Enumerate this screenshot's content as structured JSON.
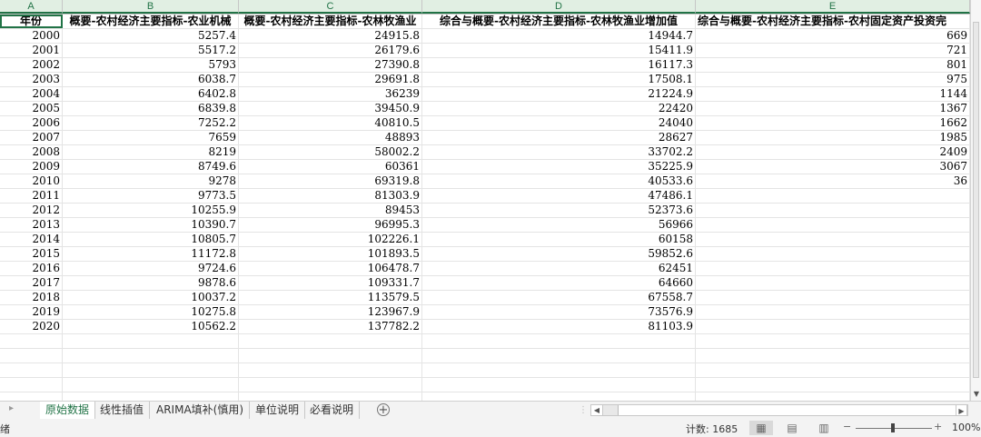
{
  "columns": [
    "A",
    "B",
    "C",
    "D",
    "E"
  ],
  "headers": [
    "年份",
    "概要-农村经济主要指标-农业机械",
    "概要-农村经济主要指标-农林牧渔业",
    "综合与概要-农村经济主要指标-农林牧渔业增加值",
    "综合与概要-农村经济主要指标-农村固定资产投资完"
  ],
  "rows": [
    [
      "2000",
      "5257.4",
      "24915.8",
      "14944.7",
      "669"
    ],
    [
      "2001",
      "5517.2",
      "26179.6",
      "15411.9",
      "721"
    ],
    [
      "2002",
      "5793",
      "27390.8",
      "16117.3",
      "801"
    ],
    [
      "2003",
      "6038.7",
      "29691.8",
      "17508.1",
      "975"
    ],
    [
      "2004",
      "6402.8",
      "36239",
      "21224.9",
      "1144"
    ],
    [
      "2005",
      "6839.8",
      "39450.9",
      "22420",
      "1367"
    ],
    [
      "2006",
      "7252.2",
      "40810.5",
      "24040",
      "1662"
    ],
    [
      "2007",
      "7659",
      "48893",
      "28627",
      "1985"
    ],
    [
      "2008",
      "8219",
      "58002.2",
      "33702.2",
      "2409"
    ],
    [
      "2009",
      "8749.6",
      "60361",
      "35225.9",
      "3067"
    ],
    [
      "2010",
      "9278",
      "69319.8",
      "40533.6",
      "36"
    ],
    [
      "2011",
      "9773.5",
      "81303.9",
      "47486.1",
      ""
    ],
    [
      "2012",
      "10255.9",
      "89453",
      "52373.6",
      ""
    ],
    [
      "2013",
      "10390.7",
      "96995.3",
      "56966",
      ""
    ],
    [
      "2014",
      "10805.7",
      "102226.1",
      "60158",
      ""
    ],
    [
      "2015",
      "11172.8",
      "101893.5",
      "59852.6",
      ""
    ],
    [
      "2016",
      "9724.6",
      "106478.7",
      "62451",
      ""
    ],
    [
      "2017",
      "9878.6",
      "109331.7",
      "64660",
      ""
    ],
    [
      "2018",
      "10037.2",
      "113579.5",
      "67558.7",
      ""
    ],
    [
      "2019",
      "10275.8",
      "123967.9",
      "73576.9",
      ""
    ],
    [
      "2020",
      "10562.2",
      "137782.2",
      "81103.9",
      ""
    ]
  ],
  "tabs": [
    "原始数据",
    "线性插值",
    "ARIMA填补(慎用)",
    "单位说明",
    "必看说明"
  ],
  "active_tab_index": 0,
  "status": {
    "ready": "绪",
    "count": "计数: 1685",
    "zoom": "100%",
    "zoom_minus": "−",
    "zoom_plus": "+"
  },
  "colors": {
    "accent": "#217346"
  },
  "icons": [
    "tab-left-icon",
    "add-sheet-icon",
    "normal-view-icon",
    "page-layout-icon",
    "page-break-icon",
    "scroll-left-icon",
    "scroll-right-icon",
    "scroll-down-icon"
  ]
}
